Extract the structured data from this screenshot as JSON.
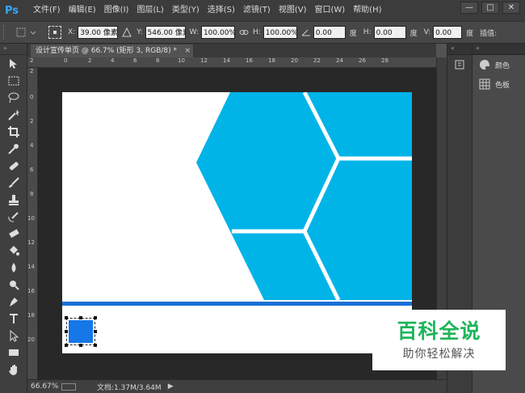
{
  "app": {
    "logo": "Ps"
  },
  "menu": [
    "文件(F)",
    "编辑(E)",
    "图像(I)",
    "图层(L)",
    "类型(Y)",
    "选择(S)",
    "滤镜(T)",
    "视图(V)",
    "窗口(W)",
    "帮助(H)"
  ],
  "window_controls": {
    "minimize": "—",
    "restore": "□",
    "close": "✕"
  },
  "options_bar": {
    "x_label": "X:",
    "x_value": "39.00 像素",
    "y_label": "Y:",
    "y_value": "546.00 像素",
    "w_label": "W:",
    "w_value": "100.00%",
    "h_label": "H:",
    "h_value": "100.00%",
    "angle_value": "0.00",
    "angle_unit": "度",
    "hskew_label": "H:",
    "hskew_value": "0.00",
    "hskew_unit": "度",
    "vskew_label": "V:",
    "vskew_value": "0.00",
    "vskew_unit": "度",
    "interp_label": "插值:"
  },
  "document_tab": {
    "title": "设计宣传单页 @ 66.7% (矩形 3, RGB/8) *",
    "close": "×"
  },
  "ruler_top_ticks": [
    "2",
    "0",
    "2",
    "4",
    "6",
    "8",
    "10",
    "12",
    "14",
    "16",
    "18",
    "20",
    "22",
    "24",
    "26",
    "28"
  ],
  "ruler_left_ticks": [
    "2",
    "0",
    "2",
    "4",
    "6",
    "8",
    "10",
    "12",
    "14",
    "16",
    "18",
    "20"
  ],
  "status": {
    "zoom": "66.67%",
    "doc": "文档:1.37M/3.64M",
    "arrow": "▶"
  },
  "panels": [
    {
      "icon": "palette-icon",
      "label": "颜色"
    },
    {
      "icon": "swatches-icon",
      "label": "色板"
    }
  ],
  "watermark": {
    "title": "百科全说",
    "subtitle": "助你轻松解决"
  },
  "colors": {
    "accent_blue": "#00b4e8",
    "rect_blue": "#1677e8",
    "line_blue": "#1a6fd8",
    "watermark_green": "#1eb45a"
  }
}
